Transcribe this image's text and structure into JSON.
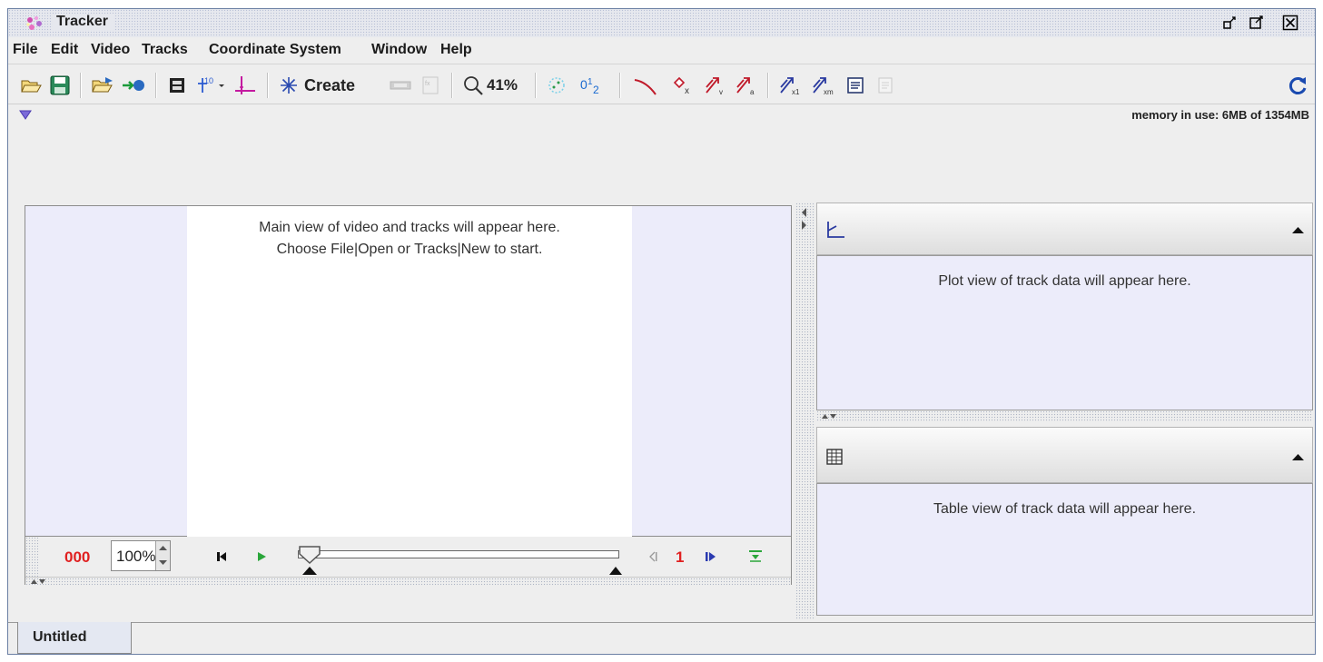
{
  "window": {
    "title": "Tracker",
    "controls": [
      "restore-icon",
      "maximize-icon",
      "close-icon"
    ]
  },
  "menubar": {
    "items": [
      "File",
      "Edit",
      "Video",
      "Tracks",
      "Coordinate System",
      "Window",
      "Help"
    ]
  },
  "toolbar": {
    "create_label": "Create",
    "zoom_label": "41%",
    "icons": [
      "open-folder-icon",
      "save-icon",
      "open-video-icon",
      "import-icon",
      "clip-settings-icon",
      "calibration-tools-icon",
      "axes-icon",
      "create-track-icon",
      "track-control-icon",
      "model-builder-icon",
      "zoom-icon",
      "autotracker-icon",
      "data-builder-icon",
      "trails-icon",
      "position-icon",
      "velocity-icon",
      "acceleration-icon",
      "vector-sum-icon",
      "center-of-mass-icon",
      "notes-icon",
      "info-icon",
      "refresh-icon"
    ]
  },
  "status": {
    "memory_text": "memory in use: 6MB of 1354MB"
  },
  "main_view": {
    "line1": "Main view of video and tracks will appear here.",
    "line2": "Choose File|Open or Tracks|New to start."
  },
  "player": {
    "frame_counter": "000",
    "zoom_value": "100%",
    "step_size": "1"
  },
  "plot_view": {
    "message": "Plot view of track data will appear here."
  },
  "table_view": {
    "message": "Table view of track data will appear here."
  },
  "tabs": [
    {
      "label": "Untitled"
    }
  ],
  "colors": {
    "window_border": "#6a7fa3",
    "panel_bg": "#ececfa",
    "frame_counter": "#e02020",
    "step_size": "#e02020"
  }
}
